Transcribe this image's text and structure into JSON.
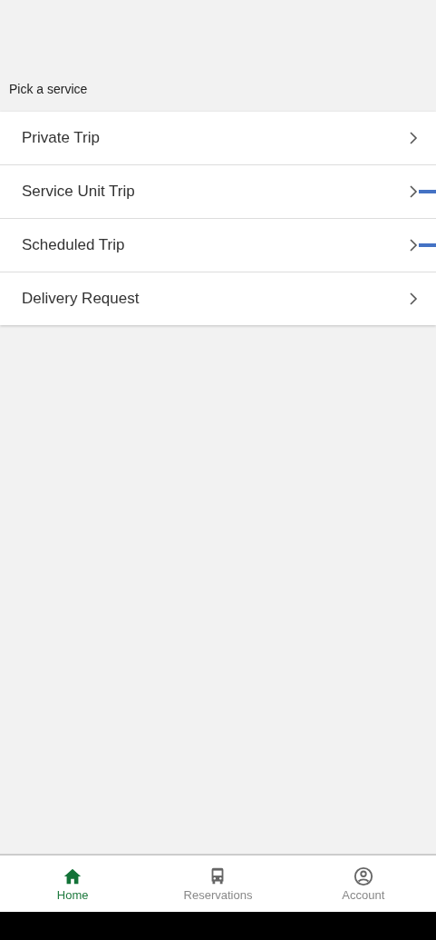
{
  "section_title": "Pick a service",
  "services": [
    {
      "label": "Private Trip",
      "marked": false
    },
    {
      "label": "Service Unit Trip",
      "marked": true
    },
    {
      "label": "Scheduled Trip",
      "marked": true
    },
    {
      "label": "Delivery Request",
      "marked": false
    }
  ],
  "nav": [
    {
      "label": "Home",
      "kind": "home",
      "selected": true
    },
    {
      "label": "Reservations",
      "kind": "bus",
      "selected": false
    },
    {
      "label": "Account",
      "kind": "account",
      "selected": false
    }
  ]
}
